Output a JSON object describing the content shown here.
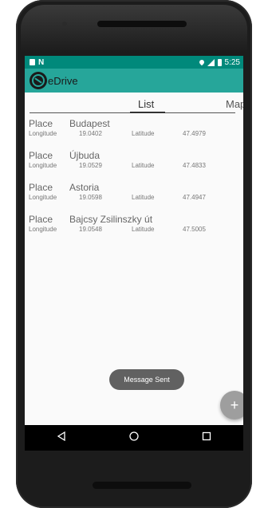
{
  "status_bar": {
    "time": "5:25"
  },
  "app_bar": {
    "title": "eDrive"
  },
  "tabs": [
    {
      "label": "List"
    },
    {
      "label": "Map"
    }
  ],
  "places": [
    {
      "place_label": "Place",
      "place": "Budapest",
      "longitude_label": "Longitude",
      "longitude": "19.0402",
      "latitude_label": "Latitude",
      "latitude": "47.4979"
    },
    {
      "place_label": "Place",
      "place": "Újbuda",
      "longitude_label": "Longitude",
      "longitude": "19.0529",
      "latitude_label": "Latitude",
      "latitude": "47.4833"
    },
    {
      "place_label": "Place",
      "place": "Astoria",
      "longitude_label": "Longitude",
      "longitude": "19.0598",
      "latitude_label": "Latitude",
      "latitude": "47.4947"
    },
    {
      "place_label": "Place",
      "place": "Bajcsy Zsilinszky út",
      "longitude_label": "Longitude",
      "longitude": "19.0548",
      "latitude_label": "Latitude",
      "latitude": "47.5005"
    }
  ],
  "toast": {
    "text": "Message Sent"
  },
  "fab": {
    "label": "+"
  },
  "colors": {
    "status_bar": "#00897b",
    "app_bar": "#26a69a",
    "fab": "#9e9e9e",
    "toast": "#616161"
  },
  "icons": [
    "sim-icon",
    "notification-icon",
    "location-icon",
    "signal-icon",
    "battery-icon",
    "logo-icon",
    "back-icon",
    "home-icon",
    "recents-icon"
  ]
}
